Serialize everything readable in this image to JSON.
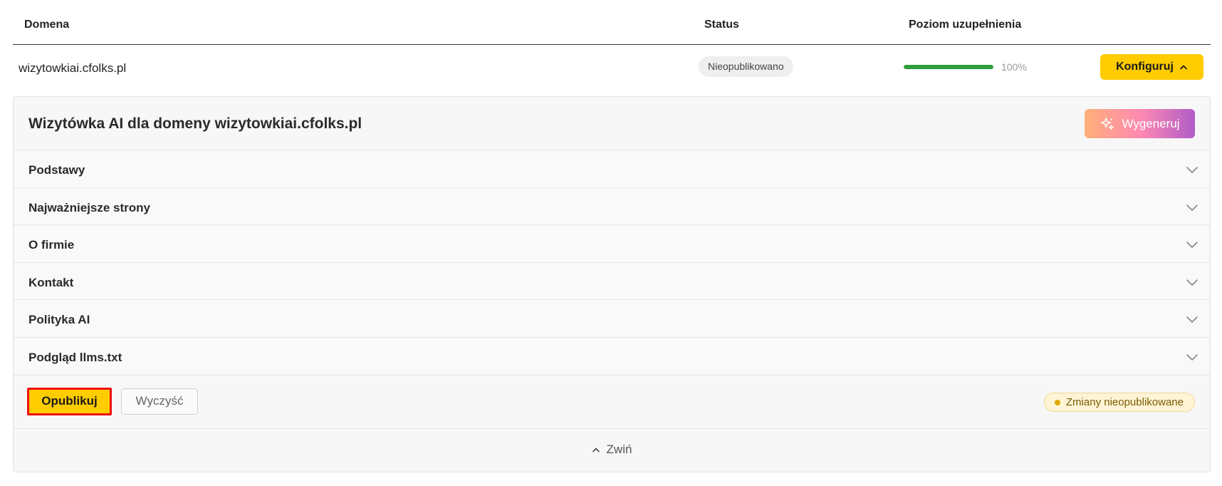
{
  "table": {
    "headers": {
      "domain": "Domena",
      "status": "Status",
      "level": "Poziom uzupełnienia"
    },
    "row": {
      "domain": "wizytowkiai.cfolks.pl",
      "status": "Nieopublikowano",
      "progress_percent": 100,
      "progress_label": "100%",
      "configure_label": "Konfiguruj"
    }
  },
  "panel": {
    "title": "Wizytówka AI dla domeny wizytowkiai.cfolks.pl",
    "generate_label": "Wygeneruj",
    "sections": [
      {
        "label": "Podstawy"
      },
      {
        "label": "Najważniejsze strony"
      },
      {
        "label": "O firmie"
      },
      {
        "label": "Kontakt"
      },
      {
        "label": "Polityka AI"
      },
      {
        "label": "Podgląd llms.txt"
      }
    ],
    "publish_label": "Opublikuj",
    "clear_label": "Wyczyść",
    "changes_badge": "Zmiany nieopublikowane",
    "collapse_label": "Zwiń"
  },
  "colors": {
    "accent_yellow": "#ffcc00",
    "progress_green": "#2e9e3a",
    "highlight_red": "#ee1111"
  },
  "icons": {
    "configure": "chevron-up-icon",
    "generate": "sparkle-icon",
    "section": "chevron-down-icon",
    "changes": "status-dot-icon",
    "collapse": "chevron-up-icon"
  }
}
